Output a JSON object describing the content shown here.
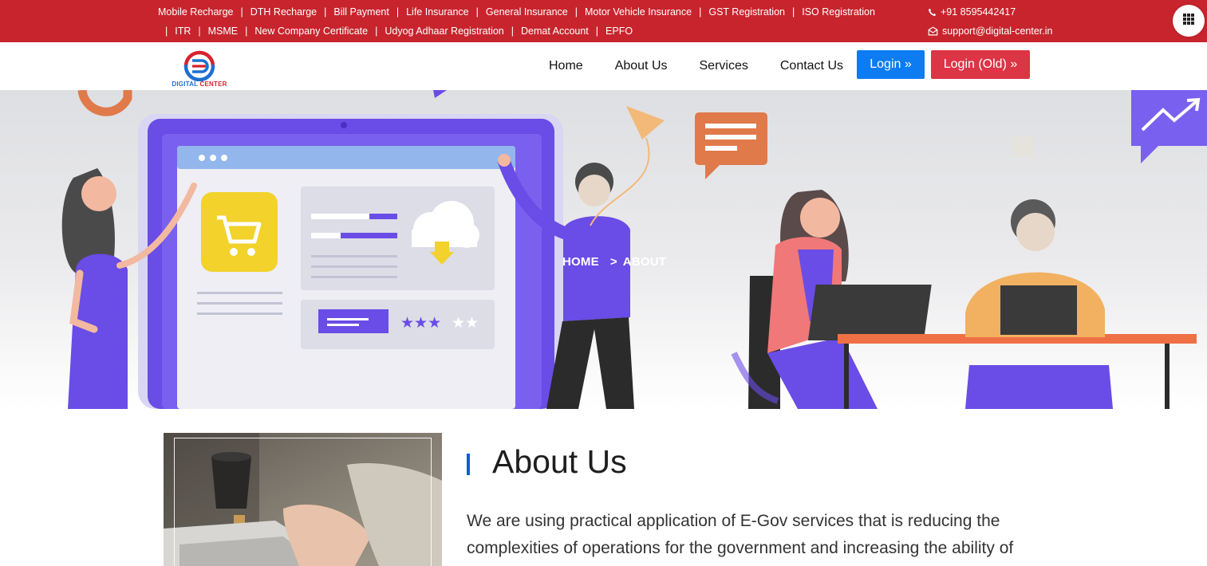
{
  "topbar": {
    "links_row1": [
      "Mobile Recharge",
      "DTH Recharge",
      "Bill Payment",
      "Life Insurance",
      "General Insurance",
      "Motor Vehicle Insurance",
      "GST Registration",
      "ISO Registration"
    ],
    "links_row2": [
      "ITR",
      "MSME",
      "New Company Certificate",
      "Udyog Adhaar Registration",
      "Demat Account",
      "EPFO"
    ],
    "separator": "|",
    "phone": "+91 8595442417",
    "email": "support@digital-center.in",
    "phone_icon": "phone-icon",
    "email_icon": "envelope-icon",
    "apps_icon": "grid-icon"
  },
  "navbar": {
    "logo_word1": "DIGITAL",
    "logo_word2": "CENTER",
    "menu": [
      "Home",
      "About Us",
      "Services",
      "Contact Us"
    ],
    "login_label": "Login »",
    "login_old_label": "Login (Old) »"
  },
  "hero": {
    "breadcrumb_home": "HOME",
    "breadcrumb_sep": ">",
    "breadcrumb_current": "ABOUT"
  },
  "about": {
    "title": "About Us",
    "paragraph": "We are using practical application of E-Gov services that is reducing the complexities of operations for the government and increasing the ability of"
  },
  "colors": {
    "topbar_red": "#c8242d",
    "login_blue": "#0d7cf2",
    "login_old_red": "#dc3545",
    "accent_blue": "#0d5fd6",
    "hero_purple": "#6a4ce6"
  }
}
